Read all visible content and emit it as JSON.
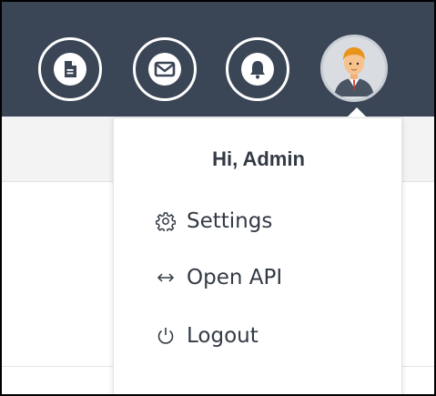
{
  "header": {
    "icons": [
      {
        "name": "document-icon"
      },
      {
        "name": "mail-icon"
      },
      {
        "name": "bell-icon"
      }
    ],
    "avatar": "avatar-icon"
  },
  "user_menu": {
    "greeting": "Hi, Admin",
    "items": [
      {
        "label": "Settings",
        "icon": "gear-icon"
      },
      {
        "label": "Open API",
        "icon": "code-arrows-icon"
      },
      {
        "label": "Logout",
        "icon": "power-icon"
      }
    ]
  },
  "colors": {
    "topbar": "#3a4556",
    "text": "#333a44",
    "panel_bg": "#f3f3f4"
  }
}
